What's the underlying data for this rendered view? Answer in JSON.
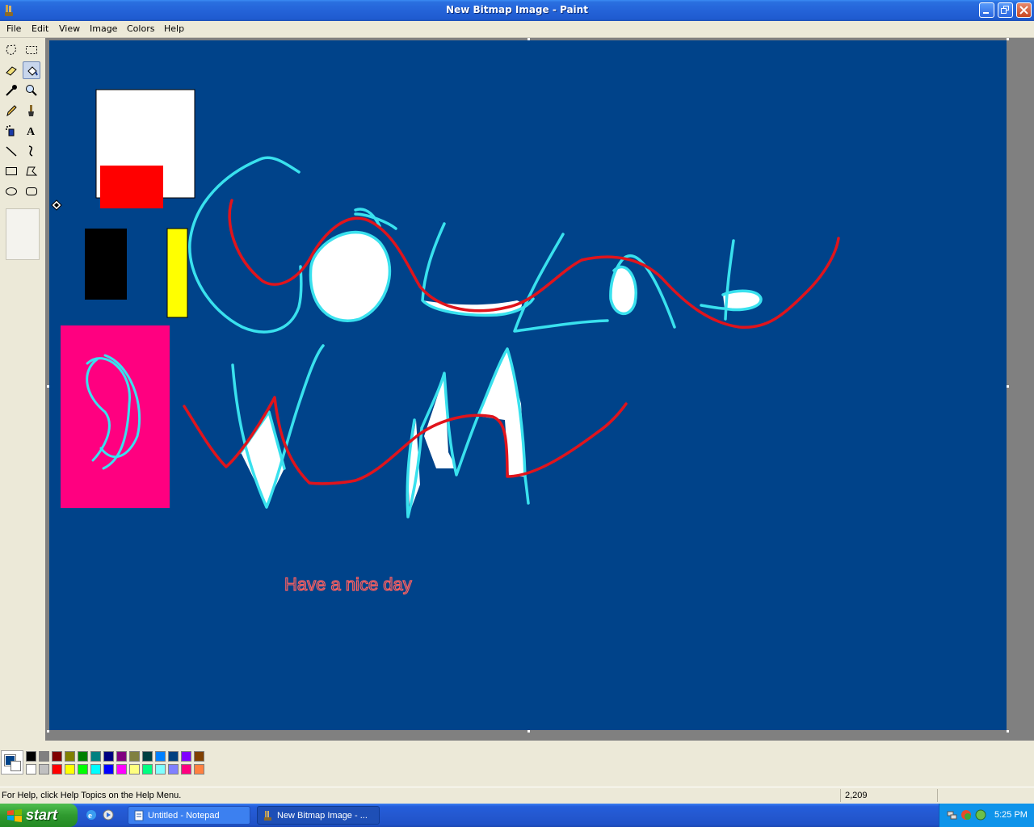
{
  "window": {
    "title": "New Bitmap Image - Paint",
    "buttons": [
      "minimize",
      "restore",
      "close"
    ]
  },
  "menu": [
    "File",
    "Edit",
    "View",
    "Image",
    "Colors",
    "Help"
  ],
  "tools": [
    {
      "name": "free-form-select",
      "icon": "free-select-icon"
    },
    {
      "name": "select",
      "icon": "select-icon"
    },
    {
      "name": "eraser",
      "icon": "eraser-icon"
    },
    {
      "name": "fill-with-color",
      "icon": "fill-bucket-icon",
      "active": true
    },
    {
      "name": "pick-color",
      "icon": "eyedropper-icon"
    },
    {
      "name": "magnifier",
      "icon": "magnifier-icon"
    },
    {
      "name": "pencil",
      "icon": "pencil-icon"
    },
    {
      "name": "brush",
      "icon": "brush-icon"
    },
    {
      "name": "airbrush",
      "icon": "airbrush-icon"
    },
    {
      "name": "text",
      "icon": "text-icon"
    },
    {
      "name": "line",
      "icon": "line-icon"
    },
    {
      "name": "curve",
      "icon": "curve-icon"
    },
    {
      "name": "rectangle",
      "icon": "rectangle-icon"
    },
    {
      "name": "polygon",
      "icon": "polygon-icon"
    },
    {
      "name": "ellipse",
      "icon": "ellipse-icon"
    },
    {
      "name": "rounded-rectangle",
      "icon": "rounded-rectangle-icon"
    }
  ],
  "canvas": {
    "background": "#00438a",
    "text_annotation": "Have a nice day"
  },
  "colors": {
    "foreground": "#00438a",
    "background": "#ffffff",
    "palette_row1": [
      "#000000",
      "#808080",
      "#800000",
      "#808000",
      "#008000",
      "#008080",
      "#000080",
      "#800080",
      "#808040",
      "#004040",
      "#0080ff",
      "#004080",
      "#8000ff",
      "#804000"
    ],
    "palette_row2": [
      "#ffffff",
      "#c0c0c0",
      "#ff0000",
      "#ffff00",
      "#00ff00",
      "#00ffff",
      "#0000ff",
      "#ff00ff",
      "#ffff80",
      "#00ff80",
      "#80ffff",
      "#8080ff",
      "#ff0080",
      "#ff8040"
    ]
  },
  "status": {
    "help_text": "For Help, click Help Topics on the Help Menu.",
    "coords": "2,209"
  },
  "taskbar": {
    "start_label": "start",
    "tasks": [
      {
        "label": "Untitled - Notepad",
        "active": false
      },
      {
        "label": "New Bitmap Image - ...",
        "active": true
      }
    ],
    "clock": "5:25 PM"
  }
}
